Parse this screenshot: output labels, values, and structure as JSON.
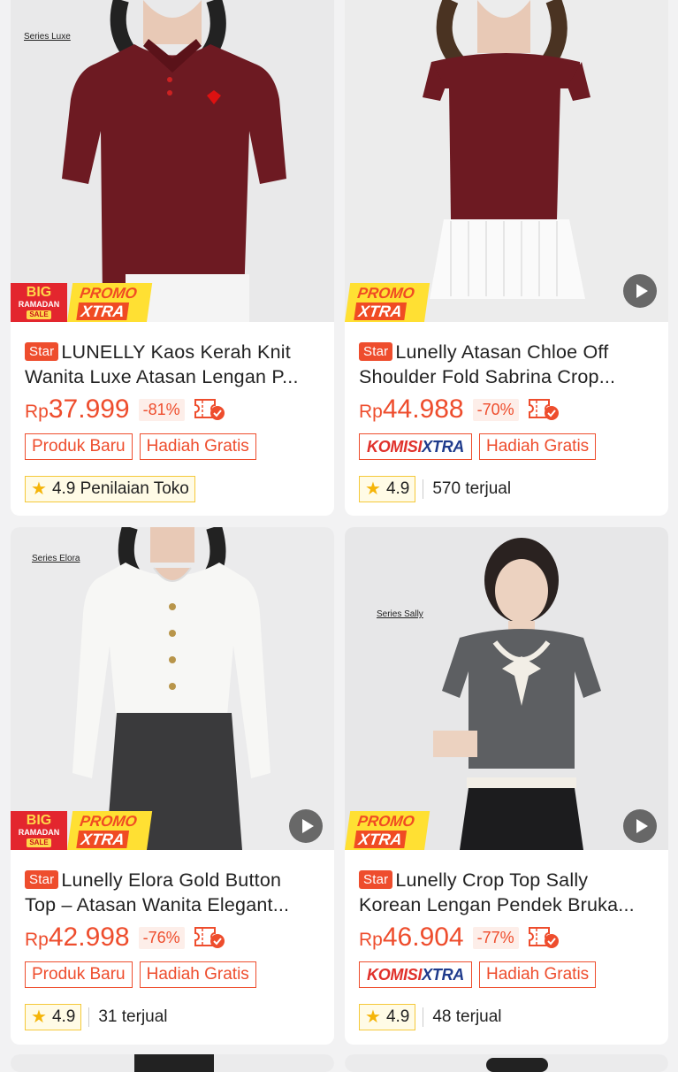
{
  "products": [
    {
      "series": "Series Luxe",
      "star_tag": "Star",
      "title_line1": "LUNELLY Kaos Kerah Knit",
      "title_line2": "Wanita Luxe Atasan Lengan P...",
      "price_currency": "Rp",
      "price_value": "37.999",
      "discount": "-81%",
      "tags": [
        "Produk Baru",
        "Hadiah Gratis"
      ],
      "rating": "4.9 Penilaian Toko",
      "sold": "",
      "badges": [
        "BIG RAMADAN SALE",
        "PROMO XTRA"
      ],
      "has_video": false
    },
    {
      "series": "",
      "star_tag": "Star",
      "title_line1": "Lunelly Atasan Chloe Off",
      "title_line2": "Shoulder Fold  Sabrina Crop...",
      "price_currency": "Rp",
      "price_value": "44.988",
      "discount": "-70%",
      "komisi": {
        "part1": "KOMISI",
        "part2": "XTRA"
      },
      "tags": [
        "Hadiah Gratis"
      ],
      "rating": "4.9",
      "sold": "570 terjual",
      "badges": [
        "PROMO XTRA"
      ],
      "has_video": true
    },
    {
      "series": "Series Elora",
      "star_tag": "Star",
      "title_line1": "Lunelly Elora Gold Button",
      "title_line2": "Top – Atasan Wanita Elegant...",
      "price_currency": "Rp",
      "price_value": "42.998",
      "discount": "-76%",
      "tags": [
        "Produk Baru",
        "Hadiah Gratis"
      ],
      "rating": "4.9",
      "sold": "31 terjual",
      "badges": [
        "BIG RAMADAN SALE",
        "PROMO XTRA"
      ],
      "has_video": true
    },
    {
      "series": "Series Sally",
      "star_tag": "Star",
      "title_line1": "Lunelly Crop Top Sally",
      "title_line2": "Korean Lengan Pendek Bruka...",
      "price_currency": "Rp",
      "price_value": "46.904",
      "discount": "-77%",
      "komisi": {
        "part1": "KOMISI",
        "part2": "XTRA"
      },
      "tags": [
        "Hadiah Gratis"
      ],
      "rating": "4.9",
      "sold": "48 terjual",
      "badges": [
        "PROMO XTRA"
      ],
      "has_video": true
    }
  ],
  "badge_text": {
    "big": "BIG",
    "ramadan": "RAMADAN",
    "sale": "SALE",
    "promo": "PROMO",
    "xtra": "XTRA"
  },
  "colors": {
    "accent": "#ee4d2d",
    "background": "#f2f2f3",
    "rating_star": "#f5b50a"
  }
}
